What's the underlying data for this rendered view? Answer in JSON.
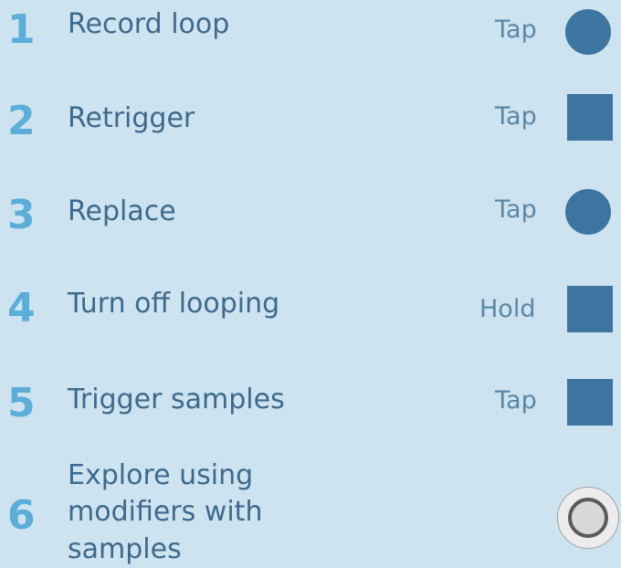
{
  "steps": [
    {
      "number": "1",
      "label": "Record loop",
      "action": "Tap",
      "button": "circle"
    },
    {
      "number": "2",
      "label": "Retrigger",
      "action": "Tap",
      "button": "square"
    },
    {
      "number": "3",
      "label": "Replace",
      "action": "Tap",
      "button": "circle"
    },
    {
      "number": "4",
      "label": "Turn off looping",
      "action": "Hold",
      "button": "square"
    },
    {
      "number": "5",
      "label": "Trigger samples",
      "action": "Tap",
      "button": "square"
    },
    {
      "number": "6",
      "label_lines": [
        "Explore using",
        "modifiers with",
        "samples"
      ],
      "action": "",
      "button": "knob"
    }
  ],
  "colors": {
    "background": "#cde3f0",
    "number": "#5aaed8",
    "label": "#3d6a8c",
    "button": "#3e74a0"
  }
}
